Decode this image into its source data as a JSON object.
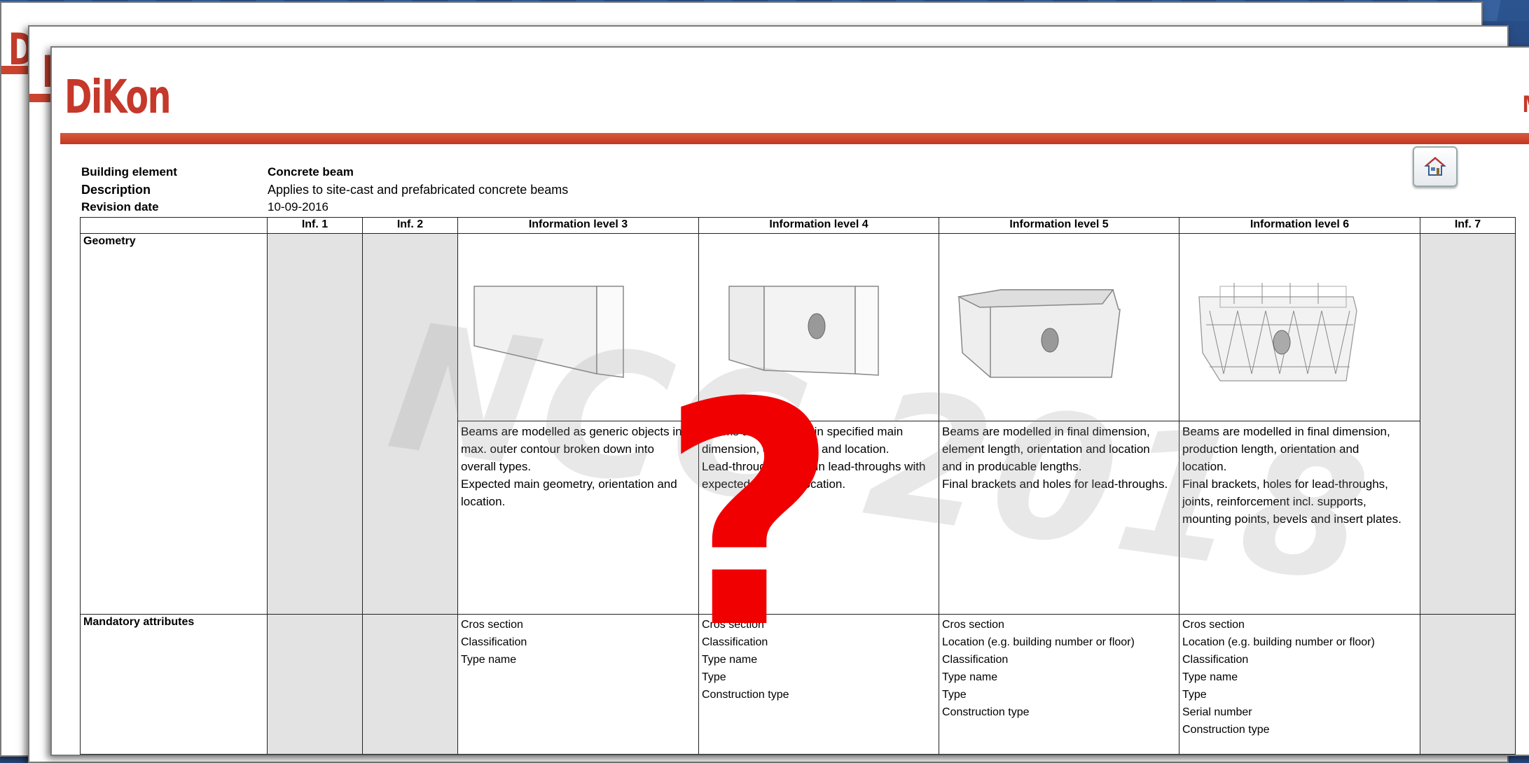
{
  "background_logo": "D",
  "document": {
    "logo": "DiKon",
    "corner_text": "M",
    "meta": [
      {
        "key": "Building element",
        "value": "Concrete beam"
      },
      {
        "key": "Description",
        "value": "Applies to site-cast and prefabricated concrete beams"
      },
      {
        "key": "Revision date",
        "value": "10-09-2016"
      }
    ],
    "columns": [
      "Inf. 1",
      "Inf. 2",
      "Information level 3",
      "Information level 4",
      "Information level 5",
      "Information level 6",
      "Inf. 7"
    ],
    "rows": {
      "geometry_label": "Geometry",
      "mandatory_label": "Mandatory attributes"
    },
    "descriptions": {
      "level3": [
        "Beams are modelled as generic objects in",
        "max. outer contour broken down into",
        "overall types.",
        "Expected main geometry, orientation and",
        "location."
      ],
      "level4": [
        "Beams are modelled in specified main",
        "dimension, orientation and location.",
        "Lead-throughs for main lead-throughs with",
        "expected size and location."
      ],
      "level5": [
        "Beams are modelled in final dimension,",
        "element length, orientation and location",
        "and in producable lengths.",
        "Final brackets and holes for lead-throughs."
      ],
      "level6": [
        "Beams are modelled in final dimension,",
        "production length, orientation and",
        "location.",
        "Final brackets, holes for lead-throughs,",
        "joints, reinforcement incl. supports,",
        "mounting points, bevels and insert plates."
      ]
    },
    "attributes": {
      "level3": [
        "Cros section",
        "Classification",
        "Type name"
      ],
      "level4": [
        "Cros section",
        "Classification",
        "Type name",
        "Type",
        "Construction type"
      ],
      "level5": [
        "Cros section",
        "Location (e.g. building number or floor)",
        "Classification",
        "Type name",
        "Type",
        "Construction type"
      ],
      "level6": [
        "Cros section",
        "Location (e.g. building number or floor)",
        "Classification",
        "Type name",
        "Type",
        "Serial number",
        "Construction type"
      ]
    },
    "watermark": "NCC 2018",
    "overlay_symbol": "?"
  },
  "icons": {
    "home": "home-icon"
  },
  "colors": {
    "brand_red": "#c5382a",
    "question_red": "#f00000",
    "gray_cell": "#e3e3e3",
    "background_blue": "#1f4278"
  }
}
